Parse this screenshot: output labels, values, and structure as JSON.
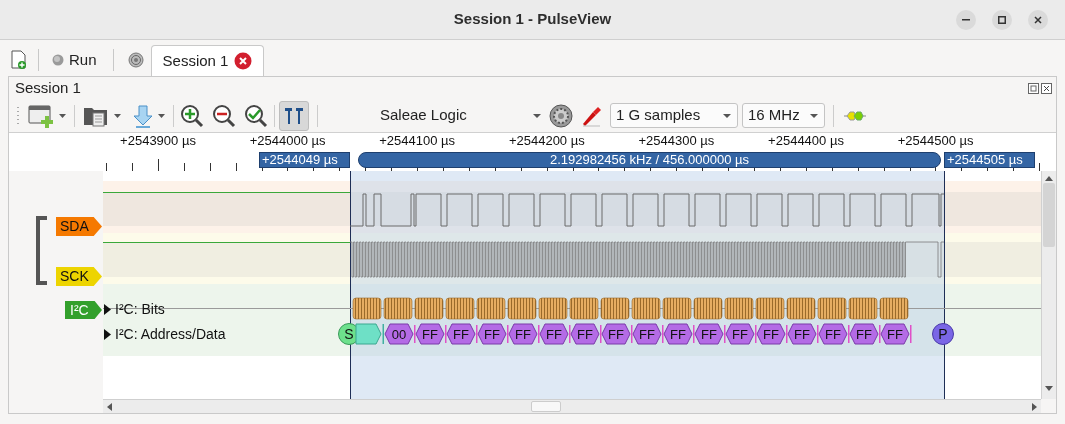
{
  "window": {
    "title": "Session 1 - PulseView"
  },
  "tabbar": {
    "run_label": "Run",
    "tabs": [
      {
        "label": "Session 1",
        "selected": true
      }
    ]
  },
  "session_label": "Session 1",
  "toolbar": {
    "cursors_selected": true,
    "device": "Saleae Logic",
    "samples": "1 G samples",
    "rate": "16 MHz"
  },
  "ruler": {
    "ticks": [
      "+2543900 µs",
      "+2544000 µs",
      "+2544100 µs",
      "+2544200 µs",
      "+2544300 µs",
      "+2544400 µs",
      "+2544500 µs"
    ]
  },
  "cursors": {
    "left": "+2544049 µs",
    "span": "2.192982456 kHz / 456.000000 µs",
    "right": "+2544505 µs"
  },
  "channels": [
    {
      "name": "SDA",
      "color": "#f57900"
    },
    {
      "name": "SCK",
      "color": "#edd400"
    }
  ],
  "decoder": {
    "name": "I²C",
    "color": "#33a02c",
    "rows": [
      {
        "label": "I²C: Bits"
      },
      {
        "label": "I²C: Address/Data"
      }
    ]
  },
  "annotations": [
    {
      "kind": "start",
      "text": "S"
    },
    {
      "kind": "address"
    },
    {
      "kind": "data",
      "text": "00"
    },
    {
      "kind": "data",
      "text": "FF"
    },
    {
      "kind": "data",
      "text": "FF"
    },
    {
      "kind": "data",
      "text": "FF"
    },
    {
      "kind": "data",
      "text": "FF"
    },
    {
      "kind": "data",
      "text": "FF"
    },
    {
      "kind": "data",
      "text": "FF"
    },
    {
      "kind": "data",
      "text": "FF"
    },
    {
      "kind": "data",
      "text": "FF"
    },
    {
      "kind": "data",
      "text": "FF"
    },
    {
      "kind": "data",
      "text": "FF"
    },
    {
      "kind": "data",
      "text": "FF"
    },
    {
      "kind": "data",
      "text": "FF"
    },
    {
      "kind": "data",
      "text": "FF"
    },
    {
      "kind": "data",
      "text": "FF"
    },
    {
      "kind": "data",
      "text": "FF"
    },
    {
      "kind": "data",
      "text": "FF"
    },
    {
      "kind": "stop",
      "text": "P"
    }
  ]
}
